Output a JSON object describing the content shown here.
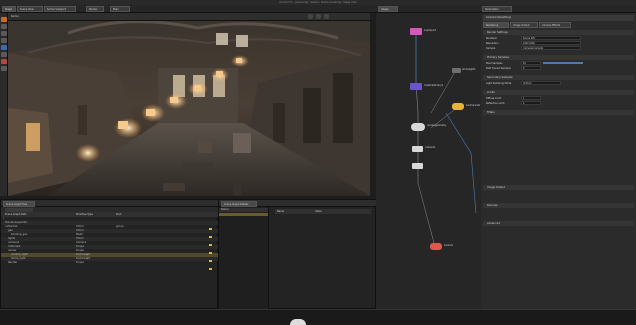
{
  "window": {
    "title": "Houdini FX - [scene.hip] - Solaris / Karma rendering - Stage view"
  },
  "tabs": [
    {
      "label": "Stage"
    },
    {
      "label": "Scene View"
    },
    {
      "label": "Karma Viewport"
    },
    {
      "label": "Render"
    },
    {
      "label": "Main"
    }
  ],
  "viewport": {
    "tab_label": "Karma",
    "title": "Viewport"
  },
  "scene_graph": {
    "tab_label": "Scene Graph Tree",
    "columns": [
      "Scene Graph Path",
      "Primitive Type",
      "Kind"
    ],
    "rows": [
      {
        "name": "/",
        "type": "",
        "kind": ""
      },
      {
        "name": "HoudiniLayerInfo",
        "type": "",
        "kind": ""
      },
      {
        "name": "cathedral",
        "type": "Xform",
        "kind": "group"
      },
      {
        "name": "geo",
        "type": "Xform",
        "kind": ""
      },
      {
        "name": "building_geo",
        "type": "Mesh",
        "kind": ""
      },
      {
        "name": "lights",
        "type": "Xform",
        "kind": ""
      },
      {
        "name": "camera1",
        "type": "Camera",
        "kind": ""
      },
      {
        "name": "materials",
        "type": "Scope",
        "kind": ""
      },
      {
        "name": "render",
        "type": "Scope",
        "kind": ""
      },
      {
        "name": "volume_light",
        "type": "DomeLight",
        "kind": ""
      },
      {
        "name": "dome_light",
        "type": "DomeLight",
        "kind": ""
      },
      {
        "name": "Render",
        "type": "Scope",
        "kind": ""
      }
    ]
  },
  "middle_panel": {
    "tab_label": "Scene Graph Details",
    "columns": [
      "Name",
      "Value"
    ]
  },
  "network": {
    "tab_label": "/stage",
    "nodes": [
      {
        "label": "sopimport"
      },
      {
        "label": "materiallibrary1"
      },
      {
        "label": "domelight1"
      },
      {
        "label": "karmarendersettings"
      },
      {
        "label": "rendergeometry"
      },
      {
        "label": "camera1"
      },
      {
        "label": "karma1"
      }
    ]
  },
  "parameters": {
    "tab_label": "Parameters",
    "node_name": "karmarendersettings",
    "tabs": [
      "Rendering",
      "Image Output",
      "Camera Effects"
    ],
    "sections": [
      {
        "label": "Render Settings"
      },
      {
        "label": "Primary Samples"
      },
      {
        "label": "Secondary Samples"
      },
      {
        "label": "Limits"
      },
      {
        "label": "Filters"
      },
      {
        "label": "Image Output"
      },
      {
        "label": "Denoise"
      },
      {
        "label": "Advanced"
      }
    ],
    "fields": [
      {
        "name": "Renderer",
        "value": "Karma XPU"
      },
      {
        "name": "Resolution",
        "value": "1920  1080"
      },
      {
        "name": "Pixel Samples",
        "value": "64"
      },
      {
        "name": "Camera",
        "value": "/cameras/camera1"
      },
      {
        "name": "Path Traced Samples",
        "value": "9"
      },
      {
        "name": "Light Sampling Mode",
        "value": "Uniform"
      },
      {
        "name": "Diffuse Limit",
        "value": "1"
      },
      {
        "name": "Reflection Limit",
        "value": "4"
      }
    ]
  },
  "colors": {
    "node_pink": "#d45ab8",
    "node_purple": "#6a55c7",
    "node_yellow": "#e6b43c",
    "node_white": "#d8d8d8",
    "node_red": "#e2574c",
    "wire_blue": "#4c7db0"
  }
}
